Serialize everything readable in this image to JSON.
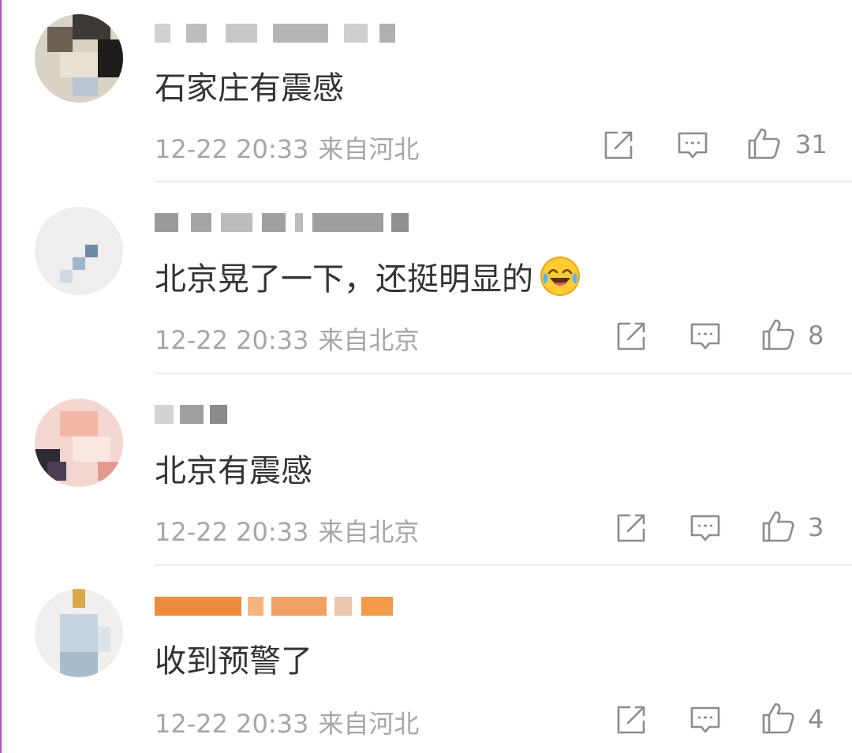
{
  "comments": [
    {
      "text": "石家庄有震感",
      "time": "12-22 20:33",
      "location": "来自河北",
      "likes": "31"
    },
    {
      "text": "北京晃了一下，还挺明显的",
      "time": "12-22 20:33",
      "location": "来自北京",
      "likes": "8"
    },
    {
      "text": "北京有震感",
      "time": "12-22 20:33",
      "location": "来自北京",
      "likes": "3"
    },
    {
      "text": "收到预警了",
      "time": "12-22 20:33",
      "location": "来自河北",
      "likes": "4"
    }
  ],
  "icons": {
    "repost": "repost-icon",
    "comment": "comment-icon",
    "like": "thumbs-up-icon",
    "emoji": "laughing-crying-emoji"
  },
  "colors": {
    "text": "#333333",
    "meta": "#a6a6a6",
    "icon": "#8c8c8c",
    "divider": "#ececec"
  }
}
